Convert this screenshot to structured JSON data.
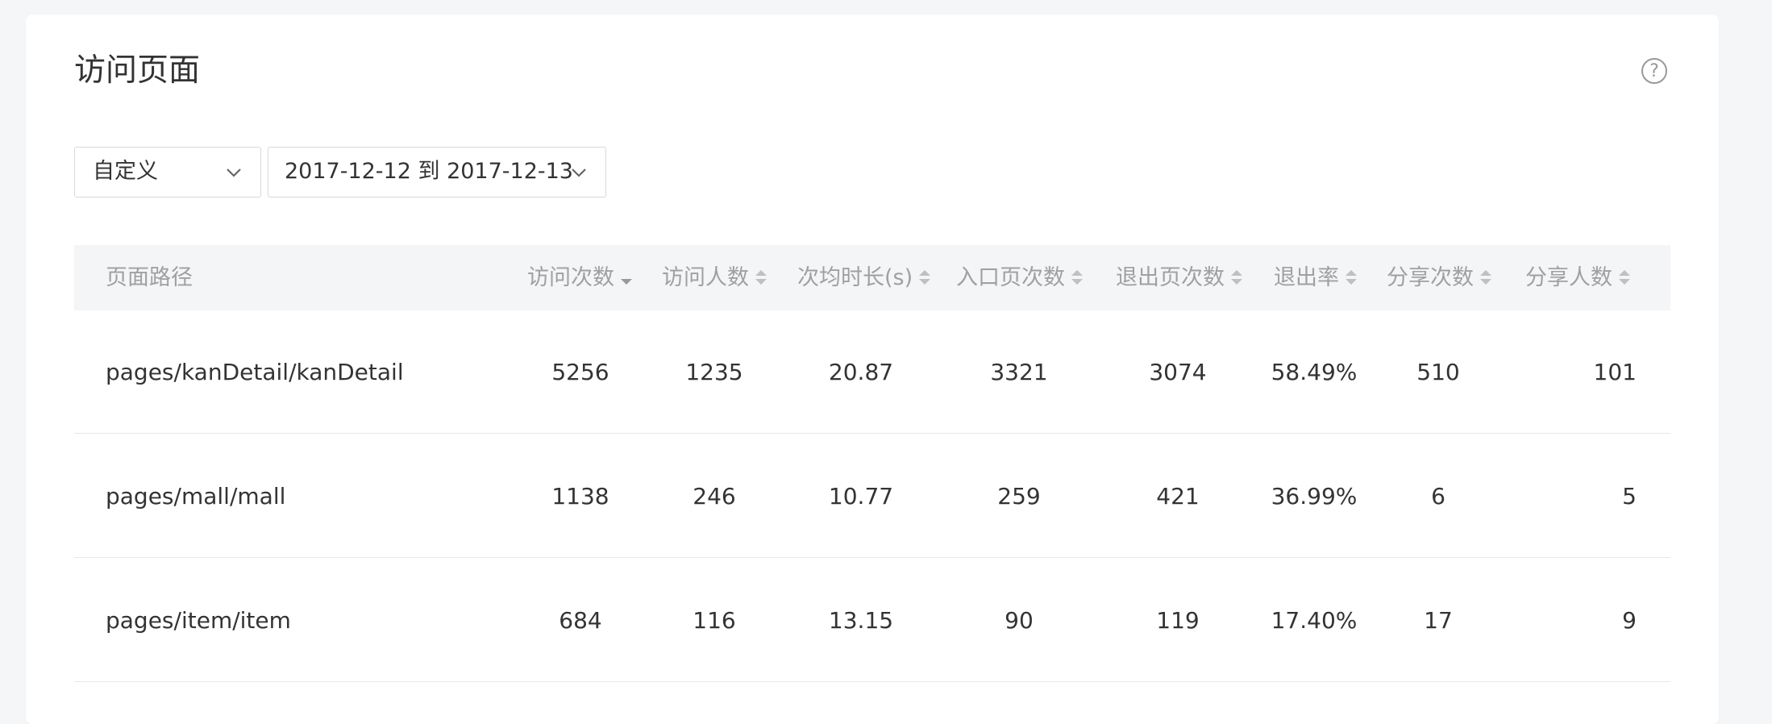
{
  "page": {
    "title": "访问页面",
    "help_symbol": "?"
  },
  "filters": {
    "range_type": "自定义",
    "date_range": "2017-12-12 到 2017-12-13"
  },
  "table": {
    "columns": [
      "页面路径",
      "访问次数",
      "访问人数",
      "次均时长(s)",
      "入口页次数",
      "退出页次数",
      "退出率",
      "分享次数",
      "分享人数"
    ],
    "sorted_column": "访问次数",
    "sort_direction": "descending",
    "rows": [
      [
        "pages/kanDetail/kanDetail",
        "5256",
        "1235",
        "20.87",
        "3321",
        "3074",
        "58.49%",
        "510",
        "101"
      ],
      [
        "pages/mall/mall",
        "1138",
        "246",
        "10.77",
        "259",
        "421",
        "36.99%",
        "6",
        "5"
      ],
      [
        "pages/item/item",
        "684",
        "116",
        "13.15",
        "90",
        "119",
        "17.40%",
        "17",
        "9"
      ]
    ]
  },
  "colors": {
    "header_bg": "#f4f5f7",
    "header_text": "#a0a0a0",
    "sort_icon": "#c0c0c0",
    "sort_active": "#9a9a9a",
    "text": "#333333",
    "divider": "#e8e8e8"
  }
}
